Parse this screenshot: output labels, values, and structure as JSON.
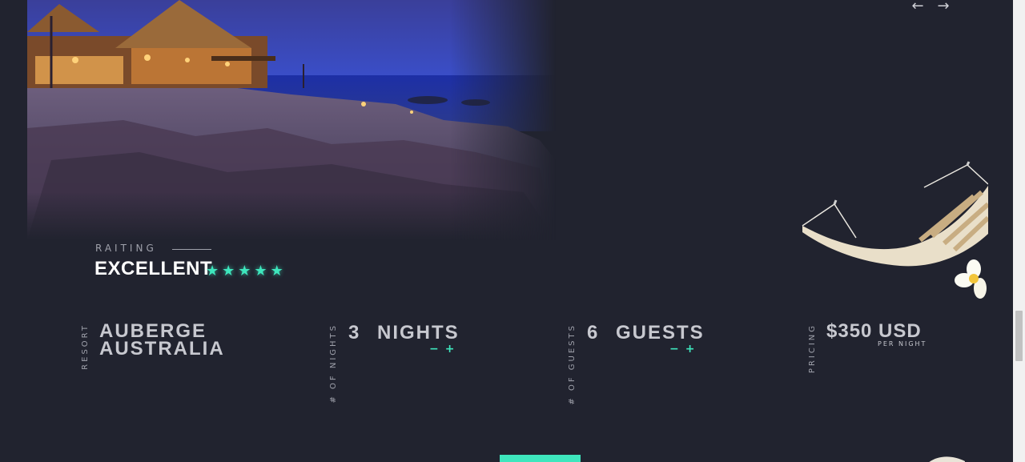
{
  "nav": {
    "prev_icon": "arrow-left-icon",
    "next_icon": "arrow-right-icon",
    "prev_glyph": "←",
    "next_glyph": "→"
  },
  "rating": {
    "label": "RAITING",
    "value": "EXCELLENT",
    "stars": 5,
    "star_glyph": "★"
  },
  "resort": {
    "label": "RESORT",
    "line1": "AUBERGE",
    "line2": "AUSTRALIA"
  },
  "nights": {
    "label": "# OF NIGHTS",
    "count": "3",
    "unit": "NIGHTS",
    "minus": "−",
    "plus": "+"
  },
  "guests": {
    "label": "# OF GUESTS",
    "count": "6",
    "unit": "GUESTS",
    "minus": "−",
    "plus": "+"
  },
  "pricing": {
    "label": "PRICING",
    "price": "$350 USD",
    "per": "PER NIGHT"
  },
  "colors": {
    "accent": "#3ee6bd",
    "background": "#21232f"
  }
}
